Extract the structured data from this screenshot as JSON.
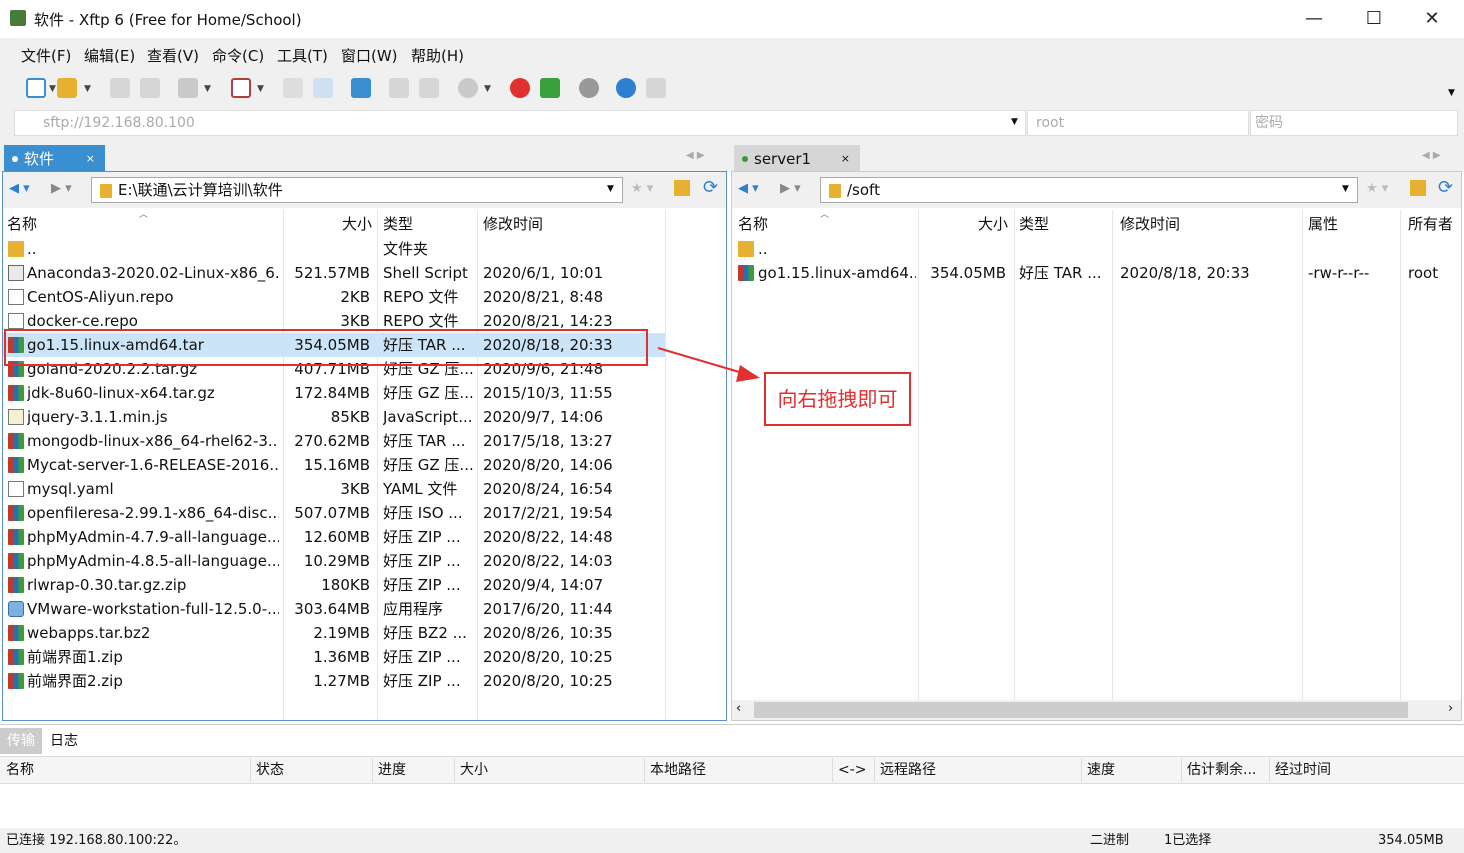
{
  "window": {
    "title": "软件 - Xftp 6 (Free for Home/School)",
    "minimize": "—",
    "maximize": "☐",
    "close": "✕"
  },
  "menu": [
    "文件(F)",
    "编辑(E)",
    "查看(V)",
    "命令(C)",
    "工具(T)",
    "窗口(W)",
    "帮助(H)"
  ],
  "address": {
    "host": "sftp://192.168.80.100",
    "user": "root",
    "password_placeholder": "密码"
  },
  "tabs": {
    "left": {
      "label": "软件",
      "close": "×"
    },
    "right": {
      "label": "server1",
      "close": "×"
    }
  },
  "left_pane": {
    "path": "E:\\联通\\云计算培训\\软件",
    "columns": [
      "名称",
      "大小",
      "类型",
      "修改时间"
    ],
    "rows": [
      {
        "icon": "folder-icon",
        "name": "..",
        "size": "",
        "type": "文件夹",
        "modified": ""
      },
      {
        "icon": "shell-script-icon",
        "name": "Anaconda3-2020.02-Linux-x86_6...",
        "size": "521.57MB",
        "type": "Shell Script",
        "modified": "2020/6/1, 10:01"
      },
      {
        "icon": "file-icon",
        "name": "CentOS-Aliyun.repo",
        "size": "2KB",
        "type": "REPO 文件",
        "modified": "2020/8/21, 8:48"
      },
      {
        "icon": "file-icon",
        "name": "docker-ce.repo",
        "size": "3KB",
        "type": "REPO 文件",
        "modified": "2020/8/21, 14:23"
      },
      {
        "icon": "archive-icon",
        "name": "go1.15.linux-amd64.tar",
        "size": "354.05MB",
        "type": "好压 TAR ...",
        "modified": "2020/8/18, 20:33",
        "selected": true
      },
      {
        "icon": "archive-icon",
        "name": "goland-2020.2.2.tar.gz",
        "size": "407.71MB",
        "type": "好压 GZ 压...",
        "modified": "2020/9/6, 21:48"
      },
      {
        "icon": "archive-icon",
        "name": "jdk-8u60-linux-x64.tar.gz",
        "size": "172.84MB",
        "type": "好压 GZ 压...",
        "modified": "2015/10/3, 11:55"
      },
      {
        "icon": "javascript-icon",
        "name": "jquery-3.1.1.min.js",
        "size": "85KB",
        "type": "JavaScript...",
        "modified": "2020/9/7, 14:06"
      },
      {
        "icon": "archive-icon",
        "name": "mongodb-linux-x86_64-rhel62-3...",
        "size": "270.62MB",
        "type": "好压 TAR ...",
        "modified": "2017/5/18, 13:27"
      },
      {
        "icon": "archive-icon",
        "name": "Mycat-server-1.6-RELEASE-2016...",
        "size": "15.16MB",
        "type": "好压 GZ 压...",
        "modified": "2020/8/20, 14:06"
      },
      {
        "icon": "file-icon",
        "name": "mysql.yaml",
        "size": "3KB",
        "type": "YAML 文件",
        "modified": "2020/8/24, 16:54"
      },
      {
        "icon": "archive-icon",
        "name": "openfileresa-2.99.1-x86_64-disc...",
        "size": "507.07MB",
        "type": "好压 ISO ...",
        "modified": "2017/2/21, 19:54"
      },
      {
        "icon": "archive-icon",
        "name": "phpMyAdmin-4.7.9-all-language...",
        "size": "12.60MB",
        "type": "好压 ZIP ...",
        "modified": "2020/8/22, 14:48"
      },
      {
        "icon": "archive-icon",
        "name": "phpMyAdmin-4.8.5-all-language...",
        "size": "10.29MB",
        "type": "好压 ZIP ...",
        "modified": "2020/8/22, 14:03"
      },
      {
        "icon": "archive-icon",
        "name": "rlwrap-0.30.tar.gz.zip",
        "size": "180KB",
        "type": "好压 ZIP ...",
        "modified": "2020/9/4, 14:07"
      },
      {
        "icon": "installer-icon",
        "name": "VMware-workstation-full-12.5.0-...",
        "size": "303.64MB",
        "type": "应用程序",
        "modified": "2017/6/20, 11:44"
      },
      {
        "icon": "archive-icon",
        "name": "webapps.tar.bz2",
        "size": "2.19MB",
        "type": "好压 BZ2 ...",
        "modified": "2020/8/26, 10:35"
      },
      {
        "icon": "archive-icon",
        "name": "前端界面1.zip",
        "size": "1.36MB",
        "type": "好压 ZIP ...",
        "modified": "2020/8/20, 10:25"
      },
      {
        "icon": "archive-icon",
        "name": "前端界面2.zip",
        "size": "1.27MB",
        "type": "好压 ZIP ...",
        "modified": "2020/8/20, 10:25"
      }
    ]
  },
  "right_pane": {
    "path": "/soft",
    "columns": [
      "名称",
      "大小",
      "类型",
      "修改时间",
      "属性",
      "所有者"
    ],
    "rows": [
      {
        "icon": "folder-icon",
        "name": "..",
        "size": "",
        "type": "",
        "modified": "",
        "attrs": "",
        "owner": ""
      },
      {
        "icon": "archive-icon",
        "name": "go1.15.linux-amd64...",
        "size": "354.05MB",
        "type": "好压 TAR ...",
        "modified": "2020/8/18, 20:33",
        "attrs": "-rw-r--r--",
        "owner": "root"
      }
    ]
  },
  "annotation": {
    "text": "向右拖拽即可",
    "color": "#e03030"
  },
  "bottom_tabs": [
    "传输",
    "日志"
  ],
  "transfer_columns": [
    "名称",
    "状态",
    "进度",
    "大小",
    "本地路径",
    "<->",
    "远程路径",
    "速度",
    "估计剩余...",
    "经过时间"
  ],
  "status": {
    "connection": "已连接 192.168.80.100:22。",
    "mode": "二进制",
    "selected": "1已选择",
    "size": "354.05MB"
  }
}
